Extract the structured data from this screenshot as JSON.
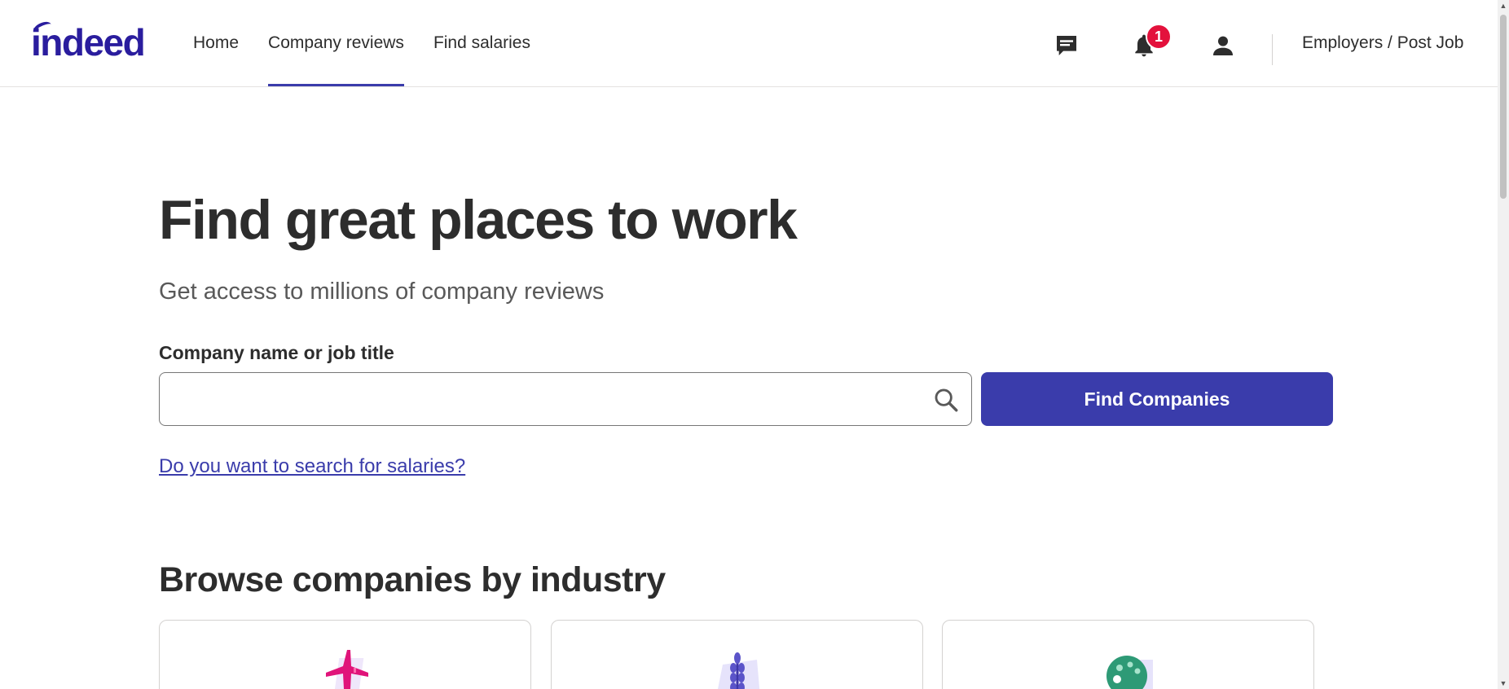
{
  "header": {
    "logo": "indeed",
    "nav": [
      {
        "label": "Home",
        "active": false
      },
      {
        "label": "Company reviews",
        "active": true
      },
      {
        "label": "Find salaries",
        "active": false
      }
    ],
    "icons": [
      "messages-icon",
      "notifications-icon",
      "account-icon"
    ],
    "notification_count": "1",
    "employers_label": "Employers / Post Job"
  },
  "hero": {
    "title": "Find great places to work",
    "subtitle": "Get access to millions of company reviews"
  },
  "search": {
    "label": "Company name or job title",
    "value": "",
    "placeholder": "",
    "button_label": "Find Companies",
    "salary_link": "Do you want to search for salaries?"
  },
  "browse": {
    "title": "Browse companies by industry",
    "cards": [
      {
        "icon": "airplane-icon",
        "color": "#e0147a"
      },
      {
        "icon": "wheat-icon",
        "color": "#5b54c9"
      },
      {
        "icon": "palette-icon",
        "color": "#2e9a76"
      }
    ]
  },
  "colors": {
    "brand": "#2a1d9e",
    "button": "#3a3cab",
    "badge": "#e3113c",
    "text": "#2d2d2d"
  }
}
